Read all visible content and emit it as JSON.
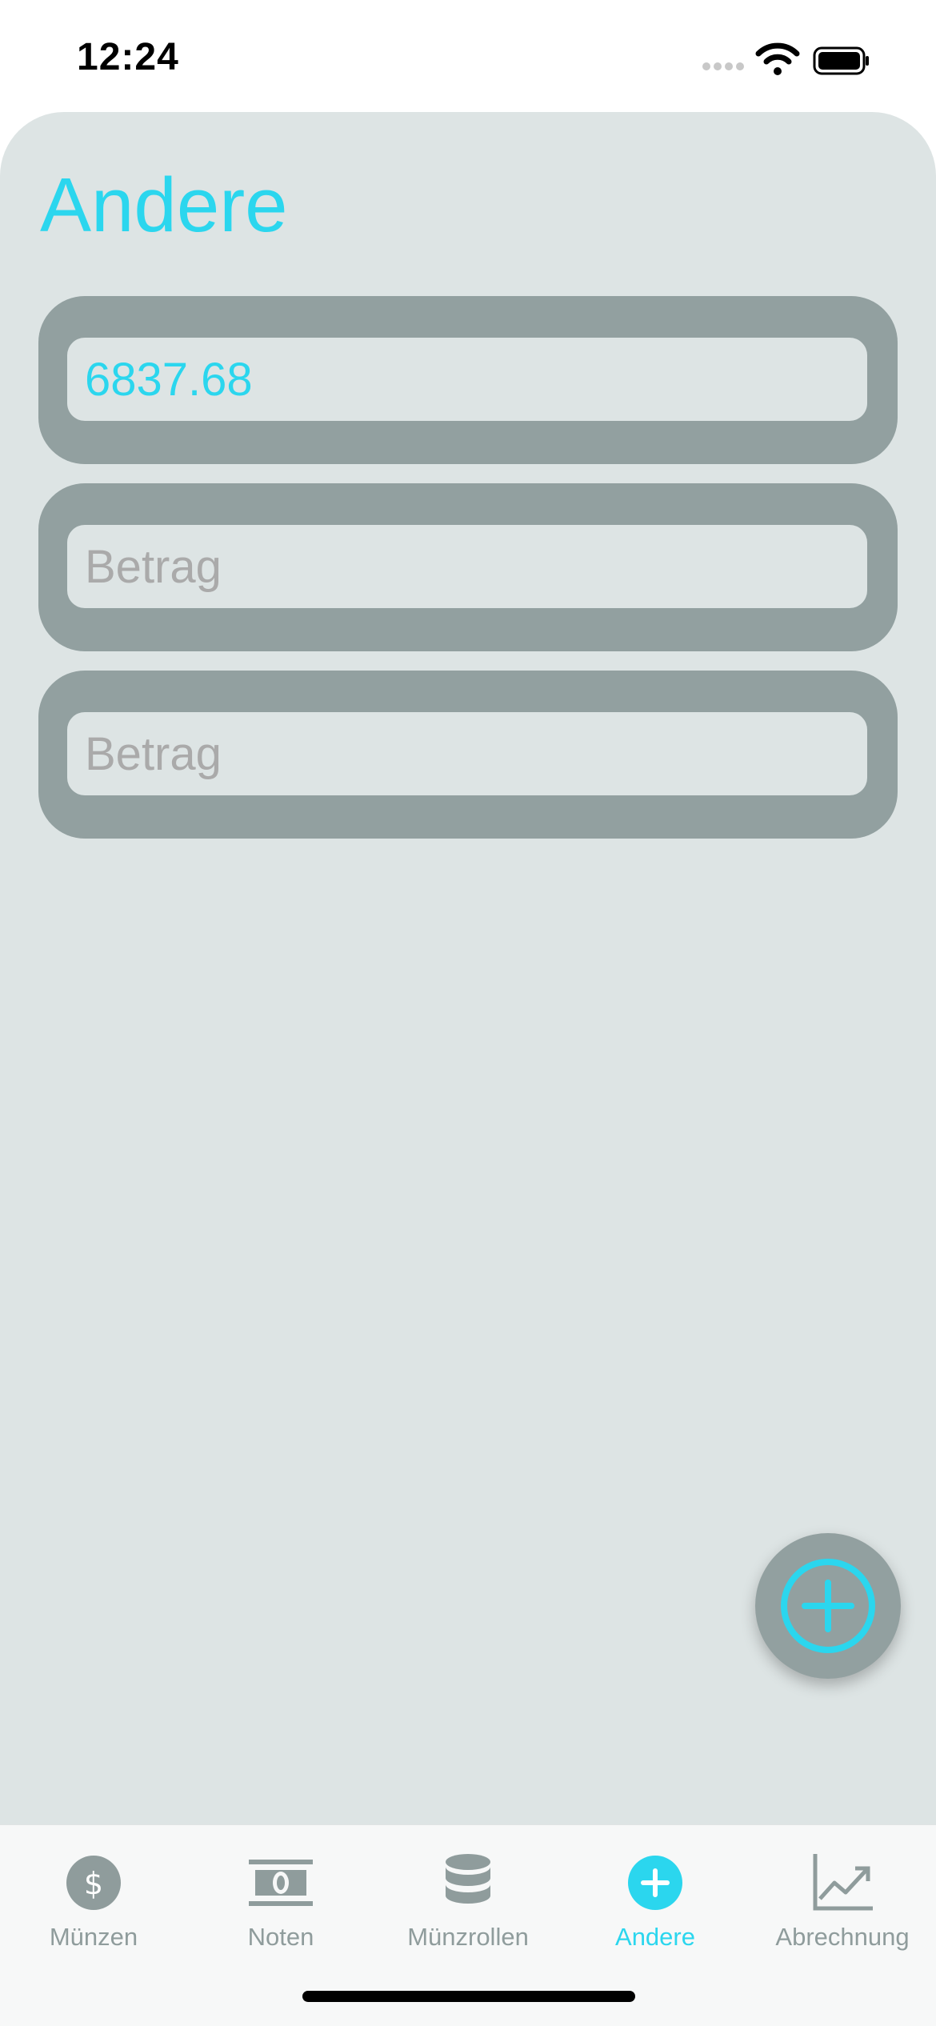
{
  "status": {
    "time": "12:24"
  },
  "page": {
    "title": "Andere"
  },
  "entries": [
    {
      "value": "6837.68",
      "placeholder": "Betrag"
    },
    {
      "value": "",
      "placeholder": "Betrag"
    },
    {
      "value": "",
      "placeholder": "Betrag"
    }
  ],
  "tabs": [
    {
      "label": "Münzen",
      "icon": "dollar-coin-icon",
      "active": false
    },
    {
      "label": "Noten",
      "icon": "banknote-icon",
      "active": false
    },
    {
      "label": "Münzrollen",
      "icon": "coin-roll-icon",
      "active": false
    },
    {
      "label": "Andere",
      "icon": "plus-circle-icon",
      "active": true
    },
    {
      "label": "Abrechnung",
      "icon": "chart-icon",
      "active": false
    }
  ],
  "colors": {
    "accent": "#2bd6ee",
    "card": "#dde4e4",
    "frame": "#92a0a0",
    "inactive": "#8f9c9c"
  }
}
